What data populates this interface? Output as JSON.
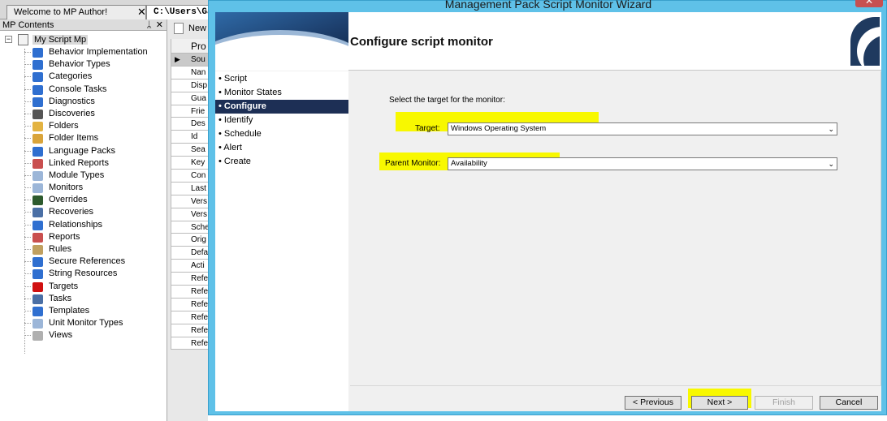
{
  "tabs": {
    "welcome": "Welcome to MP Author!",
    "close_glyph": "✕",
    "path": "C:\\Users\\Ga"
  },
  "mp_contents": {
    "header": "MP Contents",
    "pin": "ᛦ",
    "close": "✕",
    "root": "My Script Mp",
    "items": [
      {
        "label": "Behavior Implementation",
        "icon": "blue-book-icon",
        "color": "#2f6fd0"
      },
      {
        "label": "Behavior Types",
        "icon": "blue-book-icon",
        "color": "#2f6fd0"
      },
      {
        "label": "Categories",
        "icon": "blue-book-icon",
        "color": "#2f6fd0"
      },
      {
        "label": "Console Tasks",
        "icon": "blue-book-icon",
        "color": "#2f6fd0"
      },
      {
        "label": "Diagnostics",
        "icon": "blue-book-icon",
        "color": "#2f6fd0"
      },
      {
        "label": "Discoveries",
        "icon": "binoculars-icon",
        "color": "#555555"
      },
      {
        "label": "Folders",
        "icon": "folder-icon",
        "color": "#e3b341"
      },
      {
        "label": "Folder Items",
        "icon": "folder-items-icon",
        "color": "#d9a43a"
      },
      {
        "label": "Language Packs",
        "icon": "blue-book-icon",
        "color": "#2f6fd0"
      },
      {
        "label": "Linked Reports",
        "icon": "pie-chart-icon",
        "color": "#c94f4f"
      },
      {
        "label": "Module Types",
        "icon": "module-icon",
        "color": "#9cb6d8"
      },
      {
        "label": "Monitors",
        "icon": "monitor-icon",
        "color": "#9cb6d8"
      },
      {
        "label": "Overrides",
        "icon": "overrides-icon",
        "color": "#2d5a2d"
      },
      {
        "label": "Recoveries",
        "icon": "list-icon",
        "color": "#4a6fa5"
      },
      {
        "label": "Relationships",
        "icon": "blue-book-icon",
        "color": "#2f6fd0"
      },
      {
        "label": "Reports",
        "icon": "pie-chart-icon",
        "color": "#c94f4f"
      },
      {
        "label": "Rules",
        "icon": "rules-icon",
        "color": "#c0a060"
      },
      {
        "label": "Secure References",
        "icon": "blue-book-icon",
        "color": "#2f6fd0"
      },
      {
        "label": "String Resources",
        "icon": "blue-book-icon",
        "color": "#2f6fd0"
      },
      {
        "label": "Targets",
        "icon": "target-icon",
        "color": "#d01010"
      },
      {
        "label": "Tasks",
        "icon": "list-icon",
        "color": "#4a6fa5"
      },
      {
        "label": "Templates",
        "icon": "blue-book-icon",
        "color": "#2f6fd0"
      },
      {
        "label": "Unit Monitor Types",
        "icon": "module-icon",
        "color": "#9cb6d8"
      },
      {
        "label": "Views",
        "icon": "views-icon",
        "color": "#b0b0b0"
      }
    ]
  },
  "middle": {
    "new_label": "New",
    "prop_header": "Pro",
    "rows": [
      "Sou",
      "Nan",
      "Disp",
      "Gua",
      "Frie",
      "Des",
      "Id",
      "Sea",
      "Key",
      "Con",
      "Last",
      "Vers",
      "Vers",
      "Sche",
      "Orig",
      "Defa",
      "Acti",
      "Refe",
      "Refe",
      "Refe",
      "Refe",
      "Refe",
      "Refe"
    ]
  },
  "wizard": {
    "title": "Management Pack Script Monitor Wizard",
    "close": "✕",
    "page_title": "Configure script monitor",
    "nav": [
      {
        "label": "• Script",
        "active": false
      },
      {
        "label": "• Monitor States",
        "active": false
      },
      {
        "label": "• Configure",
        "active": true
      },
      {
        "label": "• Identify",
        "active": false
      },
      {
        "label": "• Schedule",
        "active": false
      },
      {
        "label": "• Alert",
        "active": false
      },
      {
        "label": "• Create",
        "active": false
      }
    ],
    "instruction": "Select the target for the monitor:",
    "target_label": "Target:",
    "target_value": "Windows Operating System",
    "parent_label": "Parent Monitor:",
    "parent_value": "Availability",
    "chevron": "⌄",
    "buttons": {
      "previous": "< Previous",
      "next": "Next >",
      "finish": "Finish",
      "cancel": "Cancel"
    },
    "highlight_color": "#f8f800"
  }
}
